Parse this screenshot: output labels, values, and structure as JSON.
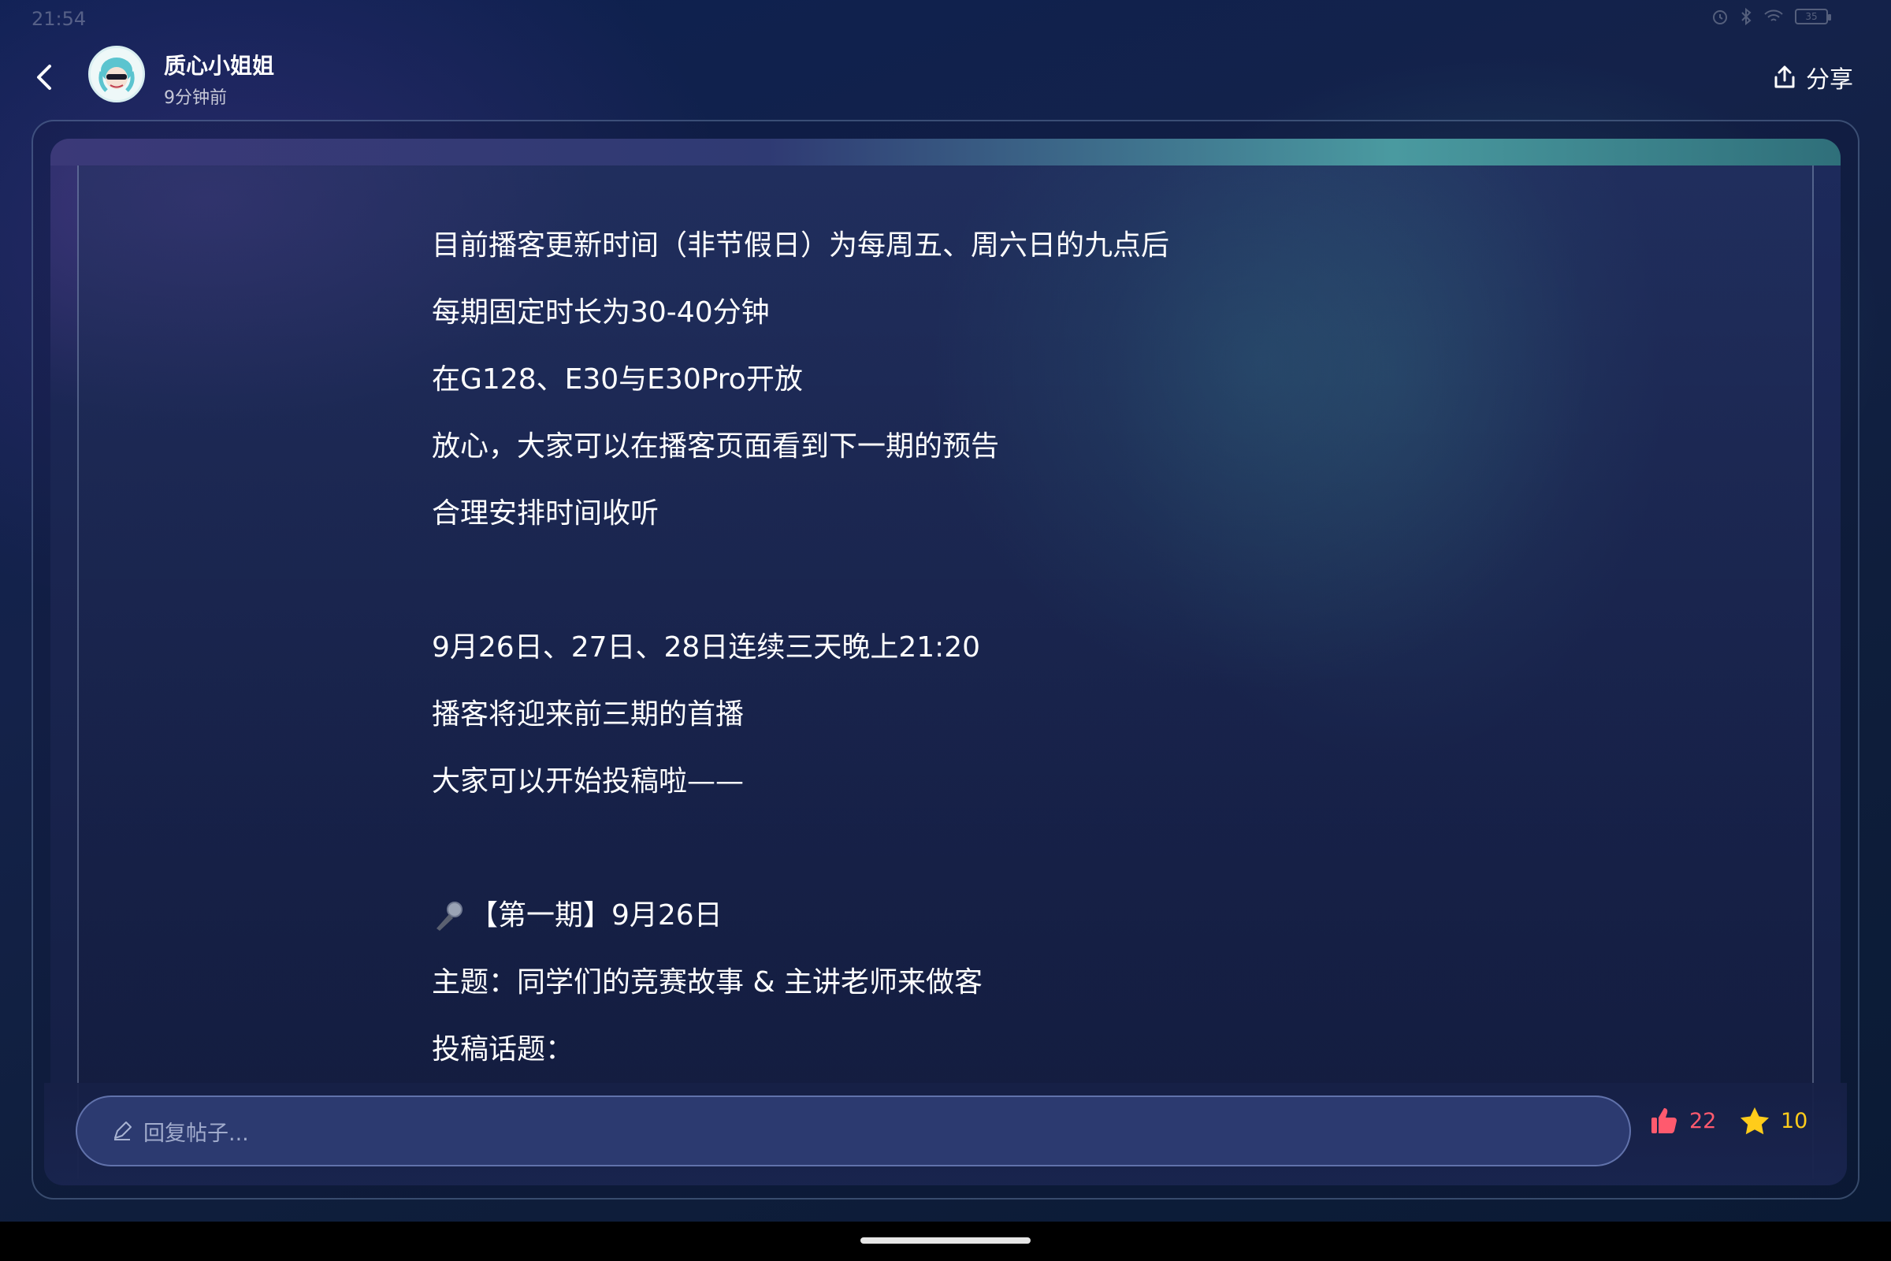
{
  "status_bar": {
    "time": "21:54",
    "battery": "35"
  },
  "header": {
    "author_name": "质心小姐姐",
    "post_time": "9分钟前",
    "share_label": "分享"
  },
  "post": {
    "lines": [
      "目前播客更新时间（非节假日）为每周五、周六日的九点后",
      "每期固定时长为30-40分钟",
      "在G128、E30与E30Pro开放",
      "放心，大家可以在播客页面看到下一期的预告",
      "合理安排时间收听",
      "",
      "9月26日、27日、28日连续三天晚上21:20",
      "播客将迎来前三期的首播",
      "大家可以开始投稿啦——",
      "",
      "【第一期】9月26日",
      "主题：同学们的竞赛故事 & 主讲老师来做客",
      "投稿话题："
    ],
    "mic_line_index": 10
  },
  "reply_bar": {
    "placeholder": "回复帖子...",
    "like_count": "22",
    "fav_count": "10",
    "like_color": "#ff5a6e",
    "fav_color": "#ffcc1a"
  },
  "icons": {
    "back": "chevron-left-icon",
    "share": "share-icon",
    "pencil": "pencil-icon",
    "like": "thumbs-up-icon",
    "fav": "star-icon",
    "mic": "microphone-icon"
  }
}
